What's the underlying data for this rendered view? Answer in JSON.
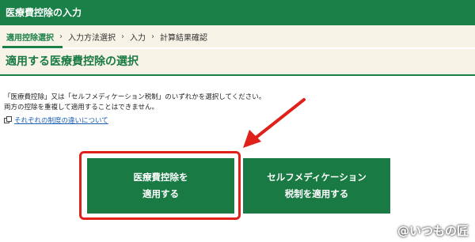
{
  "app": {
    "title": "医療費控除の入力"
  },
  "steps": [
    {
      "label": "適用控除選択",
      "active": true
    },
    {
      "label": "入力方法選択",
      "active": false
    },
    {
      "label": "入力",
      "active": false
    },
    {
      "label": "計算結果確認",
      "active": false
    }
  ],
  "page": {
    "heading": "適用する医療費控除の選択"
  },
  "description": {
    "line1": "「医療費控除」又は「セルフメディケーション税制」のいずれかを選択してください。",
    "line2": "両方の控除を重複して適用することはできません。"
  },
  "link": {
    "label": "それぞれの制度の違いについて"
  },
  "buttons": {
    "medical": {
      "line1": "医療費控除を",
      "line2": "適用する"
    },
    "self_medication": {
      "line1": "セルフメディケーション",
      "line2": "税制を適用する"
    }
  },
  "watermark": "@いつもの匠",
  "colors": {
    "primary": "#1a7a44",
    "header": "#1a8048",
    "annotation": "#e0201b",
    "band": "#f7f3e7"
  }
}
